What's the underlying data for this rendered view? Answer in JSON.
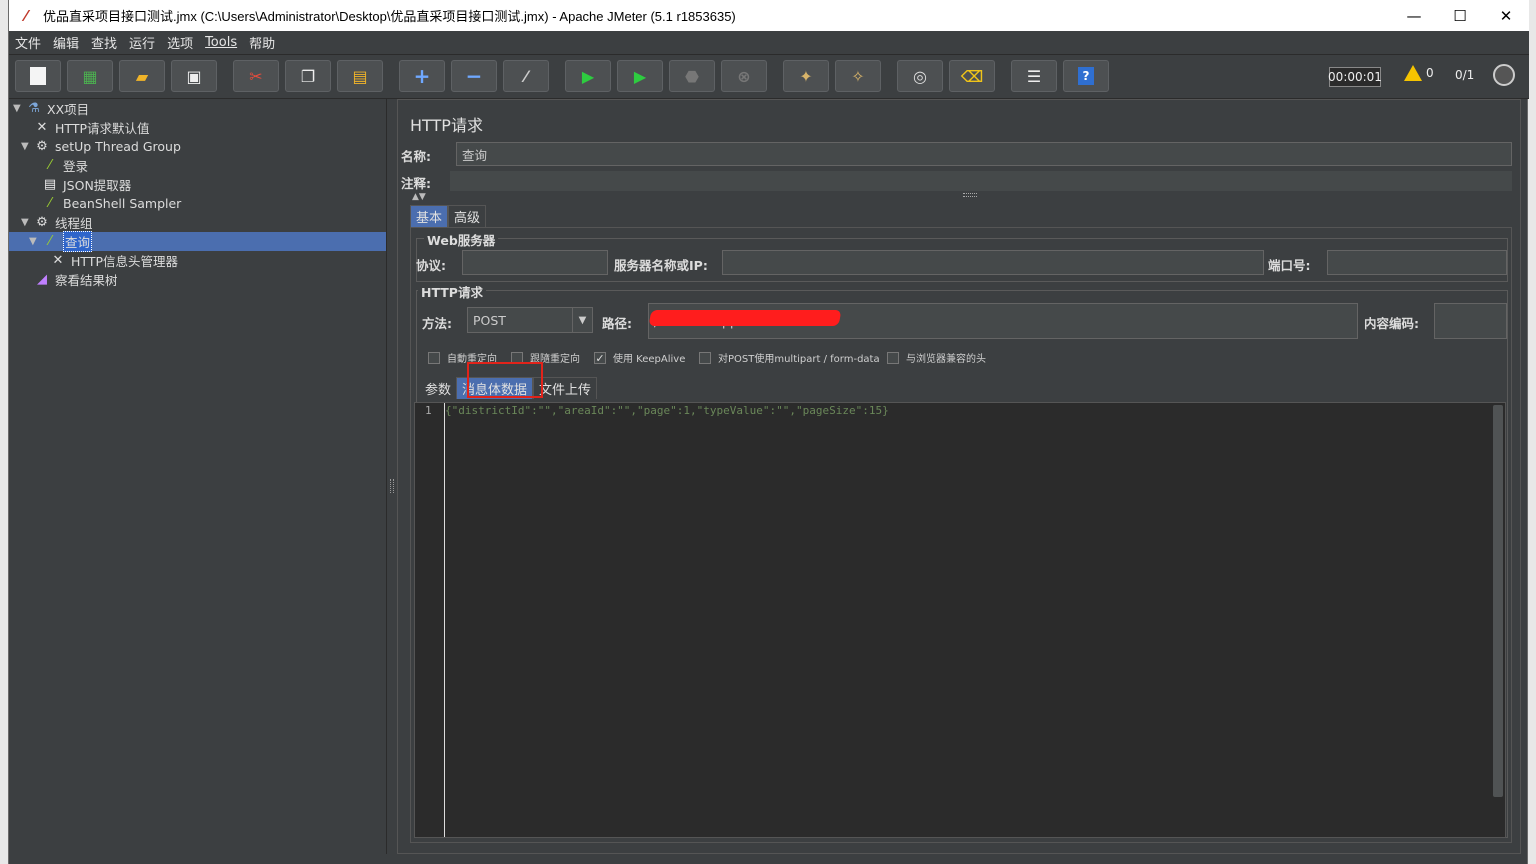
{
  "window": {
    "title": "优品直采项目接口测试.jmx (C:\\Users\\Administrator\\Desktop\\优品直采项目接口测试.jmx) - Apache JMeter (5.1 r1853635)",
    "controls": [
      "—",
      "☐",
      "✕"
    ]
  },
  "menu": [
    "文件",
    "编辑",
    "查找",
    "运行",
    "选项",
    "Tools",
    "帮助"
  ],
  "toolbar": {
    "buttons": [
      "new-icon",
      "templates-icon",
      "open-icon",
      "save-icon",
      "cut-icon",
      "copy-icon",
      "paste-icon",
      "expand-icon",
      "collapse-icon",
      "toggle-icon",
      "start-icon",
      "start-no-pause-icon",
      "stop-icon",
      "shutdown-icon",
      "clear-icon",
      "clear-all-icon",
      "search-icon",
      "reset-search-icon",
      "function-helper-icon",
      "help-icon"
    ],
    "timer": "00:00:01",
    "warnings": "0",
    "threads": "0/1"
  },
  "tree": {
    "items": [
      {
        "label": "XX项目",
        "icon": "test-plan-icon"
      },
      {
        "label": "HTTP请求默认值",
        "icon": "config-icon"
      },
      {
        "label": "setUp Thread Group",
        "icon": "thread-group-icon"
      },
      {
        "label": "登录",
        "icon": "sampler-icon"
      },
      {
        "label": "JSON提取器",
        "icon": "extractor-icon"
      },
      {
        "label": "BeanShell Sampler",
        "icon": "sampler-icon"
      },
      {
        "label": "线程组",
        "icon": "thread-group-icon"
      },
      {
        "label": "查询",
        "icon": "sampler-icon"
      },
      {
        "label": "HTTP信息头管理器",
        "icon": "config-icon"
      },
      {
        "label": "察看结果树",
        "icon": "listener-icon"
      }
    ]
  },
  "panel": {
    "title": "HTTP请求",
    "name_label": "名称:",
    "name_value": "查询",
    "comment_label": "注释:",
    "tabs": [
      "基本",
      "高级"
    ],
    "web_server": {
      "title": "Web服务器",
      "protocol_label": "协议:",
      "server_label": "服务器名称或IP:",
      "port_label": "端口号:"
    },
    "http_request": {
      "title": "HTTP请求",
      "method_label": "方法:",
      "method_value": "POST",
      "path_label": "路径:",
      "path_value": "/sci                                              istForApp",
      "encoding_label": "内容编码:"
    },
    "checkboxes": [
      {
        "label": "自動重定向",
        "checked": false
      },
      {
        "label": "跟隨重定向",
        "checked": false
      },
      {
        "label": "使用 KeepAlive",
        "checked": true
      },
      {
        "label": "对POST使用multipart / form-data",
        "checked": false
      },
      {
        "label": "与浏览器兼容的头",
        "checked": false
      }
    ],
    "body_tabs": [
      "参数",
      "消息体数据",
      "文件上传"
    ],
    "body": {
      "line_number": "1",
      "text": "{\"districtId\":\"\",\"areaId\":\"\",\"page\":1,\"typeValue\":\"\",\"pageSize\":15}"
    }
  }
}
